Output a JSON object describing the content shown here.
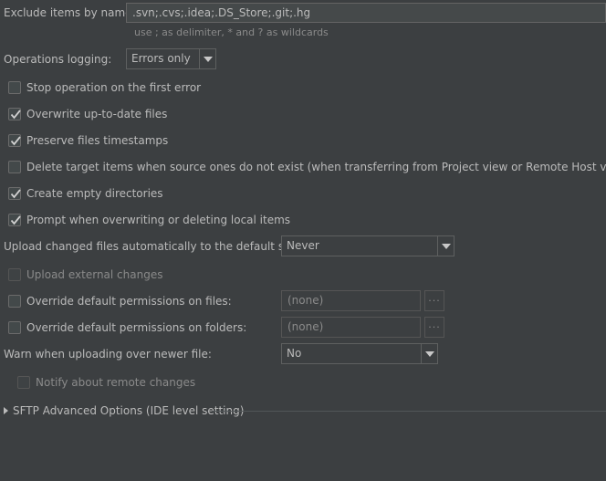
{
  "exclude": {
    "label": "Exclude items by name:",
    "value": ".svn;.cvs;.idea;.DS_Store;.git;.hg",
    "hint": "use ; as delimiter, * and ? as wildcards"
  },
  "operations_logging": {
    "label": "Operations logging:",
    "selected": "Errors only"
  },
  "checkboxes": [
    {
      "label": "Stop operation on the first error",
      "checked": false
    },
    {
      "label": "Overwrite up-to-date files",
      "checked": true
    },
    {
      "label": "Preserve files timestamps",
      "checked": true
    },
    {
      "label": "Delete target items when source ones do not exist (when transferring from Project view or Remote Host view)",
      "checked": false
    },
    {
      "label": "Create empty directories",
      "checked": true
    },
    {
      "label": "Prompt when overwriting or deleting local items",
      "checked": true
    }
  ],
  "upload_changed": {
    "label": "Upload changed files automatically to the default server",
    "selected": "Never"
  },
  "upload_external": {
    "label": "Upload external changes",
    "checked": false
  },
  "override_files": {
    "label": "Override default permissions on files:",
    "value": "(none)",
    "button": "..."
  },
  "override_folders": {
    "label": "Override default permissions on folders:",
    "value": "(none)",
    "button": "..."
  },
  "warn_newer": {
    "label": "Warn when uploading over newer file:",
    "selected": "No"
  },
  "notify_remote": {
    "label": "Notify about remote changes",
    "checked": false
  },
  "sftp_section": {
    "label": "SFTP Advanced Options (IDE level setting)"
  },
  "colors": {
    "background": "#3c3f41",
    "text": "#bbbbbb",
    "disabled_text": "#8a8a8a",
    "field_background": "#45494a"
  }
}
